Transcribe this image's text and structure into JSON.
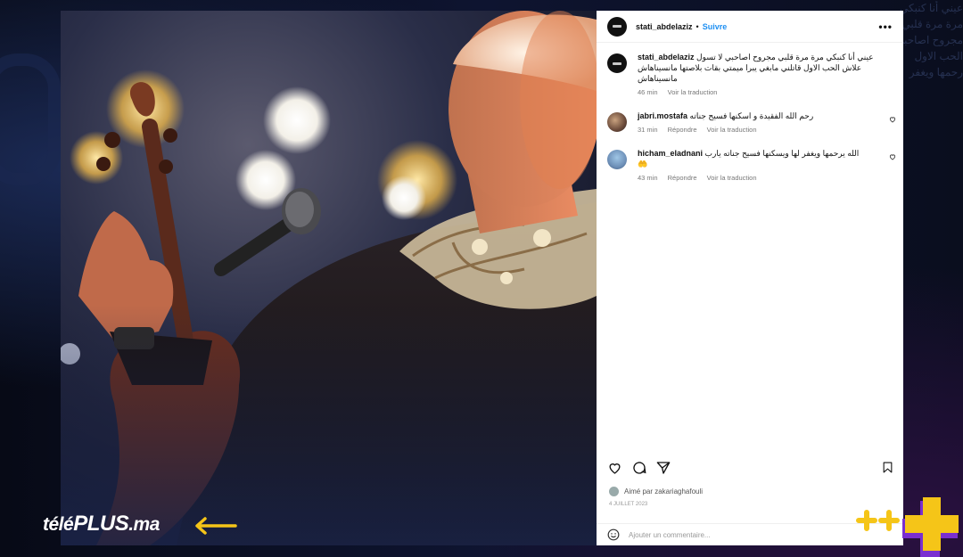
{
  "post": {
    "author": "stati_abdelaziz",
    "dot": "•",
    "follow_label": "Suivre",
    "more_label": "•••",
    "caption": {
      "user": "stati_abdelaziz",
      "text": "عيني أنا كنبكي مرة مرة قلبي مجروح اصاحبي لا تسول علاش الحب الاول قاتلني مابغي يبرا ميمتي بقات بلاصتها مانسيناهاش مانسيناهاش",
      "time": "46 min",
      "translate": "Voir la traduction"
    },
    "comments": [
      {
        "user": "jabri.mostafa",
        "text": "رحم الله الفقيدة و اسكنها فسيح جناته",
        "time": "31 min",
        "reply": "Répondre",
        "translate": "Voir la traduction"
      },
      {
        "user": "hicham_eladnani",
        "text": "الله يرحمها ويغفر لها ويسكنها فسيح جناته يارب",
        "emoji": "🤲",
        "time": "43 min",
        "reply": "Répondre",
        "translate": "Voir la traduction"
      }
    ],
    "liked_by": "Aimé par zakariaghafouli",
    "date": "4 JUILLET 2023",
    "add_comment_placeholder": "Ajouter un commentaire..."
  },
  "overlay": {
    "logo_pre": "télé",
    "logo_bold": "PLUS",
    "logo_post": ".ma"
  },
  "background": {
    "blurred_text": "عيني أنا كنبكي مرة مرة قلبي مجروح اصاحبي الحب الاول رحمها ويغفر"
  },
  "colors": {
    "accent": "#1d8ff2",
    "brand_yellow": "#f5c518",
    "brand_purple": "#7a2fd0"
  }
}
